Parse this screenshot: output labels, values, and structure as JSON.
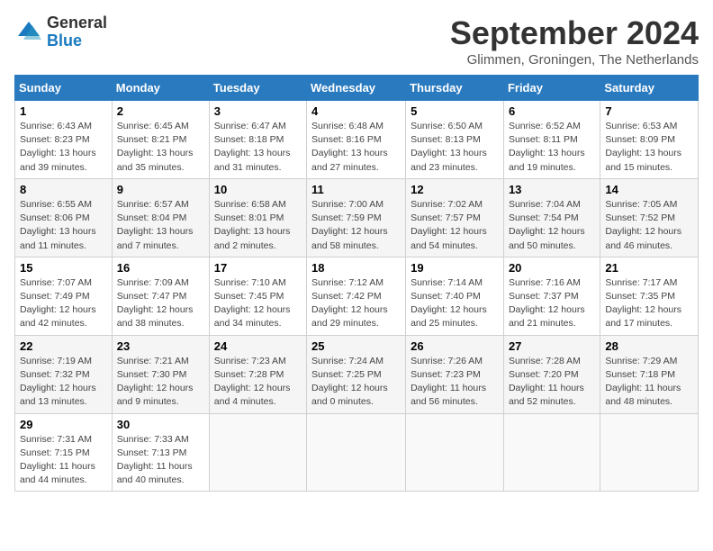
{
  "header": {
    "logo_general": "General",
    "logo_blue": "Blue",
    "month_title": "September 2024",
    "location": "Glimmen, Groningen, The Netherlands"
  },
  "weekdays": [
    "Sunday",
    "Monday",
    "Tuesday",
    "Wednesday",
    "Thursday",
    "Friday",
    "Saturday"
  ],
  "weeks": [
    [
      {
        "day": "1",
        "sunrise": "Sunrise: 6:43 AM",
        "sunset": "Sunset: 8:23 PM",
        "daylight": "Daylight: 13 hours and 39 minutes."
      },
      {
        "day": "2",
        "sunrise": "Sunrise: 6:45 AM",
        "sunset": "Sunset: 8:21 PM",
        "daylight": "Daylight: 13 hours and 35 minutes."
      },
      {
        "day": "3",
        "sunrise": "Sunrise: 6:47 AM",
        "sunset": "Sunset: 8:18 PM",
        "daylight": "Daylight: 13 hours and 31 minutes."
      },
      {
        "day": "4",
        "sunrise": "Sunrise: 6:48 AM",
        "sunset": "Sunset: 8:16 PM",
        "daylight": "Daylight: 13 hours and 27 minutes."
      },
      {
        "day": "5",
        "sunrise": "Sunrise: 6:50 AM",
        "sunset": "Sunset: 8:13 PM",
        "daylight": "Daylight: 13 hours and 23 minutes."
      },
      {
        "day": "6",
        "sunrise": "Sunrise: 6:52 AM",
        "sunset": "Sunset: 8:11 PM",
        "daylight": "Daylight: 13 hours and 19 minutes."
      },
      {
        "day": "7",
        "sunrise": "Sunrise: 6:53 AM",
        "sunset": "Sunset: 8:09 PM",
        "daylight": "Daylight: 13 hours and 15 minutes."
      }
    ],
    [
      {
        "day": "8",
        "sunrise": "Sunrise: 6:55 AM",
        "sunset": "Sunset: 8:06 PM",
        "daylight": "Daylight: 13 hours and 11 minutes."
      },
      {
        "day": "9",
        "sunrise": "Sunrise: 6:57 AM",
        "sunset": "Sunset: 8:04 PM",
        "daylight": "Daylight: 13 hours and 7 minutes."
      },
      {
        "day": "10",
        "sunrise": "Sunrise: 6:58 AM",
        "sunset": "Sunset: 8:01 PM",
        "daylight": "Daylight: 13 hours and 2 minutes."
      },
      {
        "day": "11",
        "sunrise": "Sunrise: 7:00 AM",
        "sunset": "Sunset: 7:59 PM",
        "daylight": "Daylight: 12 hours and 58 minutes."
      },
      {
        "day": "12",
        "sunrise": "Sunrise: 7:02 AM",
        "sunset": "Sunset: 7:57 PM",
        "daylight": "Daylight: 12 hours and 54 minutes."
      },
      {
        "day": "13",
        "sunrise": "Sunrise: 7:04 AM",
        "sunset": "Sunset: 7:54 PM",
        "daylight": "Daylight: 12 hours and 50 minutes."
      },
      {
        "day": "14",
        "sunrise": "Sunrise: 7:05 AM",
        "sunset": "Sunset: 7:52 PM",
        "daylight": "Daylight: 12 hours and 46 minutes."
      }
    ],
    [
      {
        "day": "15",
        "sunrise": "Sunrise: 7:07 AM",
        "sunset": "Sunset: 7:49 PM",
        "daylight": "Daylight: 12 hours and 42 minutes."
      },
      {
        "day": "16",
        "sunrise": "Sunrise: 7:09 AM",
        "sunset": "Sunset: 7:47 PM",
        "daylight": "Daylight: 12 hours and 38 minutes."
      },
      {
        "day": "17",
        "sunrise": "Sunrise: 7:10 AM",
        "sunset": "Sunset: 7:45 PM",
        "daylight": "Daylight: 12 hours and 34 minutes."
      },
      {
        "day": "18",
        "sunrise": "Sunrise: 7:12 AM",
        "sunset": "Sunset: 7:42 PM",
        "daylight": "Daylight: 12 hours and 29 minutes."
      },
      {
        "day": "19",
        "sunrise": "Sunrise: 7:14 AM",
        "sunset": "Sunset: 7:40 PM",
        "daylight": "Daylight: 12 hours and 25 minutes."
      },
      {
        "day": "20",
        "sunrise": "Sunrise: 7:16 AM",
        "sunset": "Sunset: 7:37 PM",
        "daylight": "Daylight: 12 hours and 21 minutes."
      },
      {
        "day": "21",
        "sunrise": "Sunrise: 7:17 AM",
        "sunset": "Sunset: 7:35 PM",
        "daylight": "Daylight: 12 hours and 17 minutes."
      }
    ],
    [
      {
        "day": "22",
        "sunrise": "Sunrise: 7:19 AM",
        "sunset": "Sunset: 7:32 PM",
        "daylight": "Daylight: 12 hours and 13 minutes."
      },
      {
        "day": "23",
        "sunrise": "Sunrise: 7:21 AM",
        "sunset": "Sunset: 7:30 PM",
        "daylight": "Daylight: 12 hours and 9 minutes."
      },
      {
        "day": "24",
        "sunrise": "Sunrise: 7:23 AM",
        "sunset": "Sunset: 7:28 PM",
        "daylight": "Daylight: 12 hours and 4 minutes."
      },
      {
        "day": "25",
        "sunrise": "Sunrise: 7:24 AM",
        "sunset": "Sunset: 7:25 PM",
        "daylight": "Daylight: 12 hours and 0 minutes."
      },
      {
        "day": "26",
        "sunrise": "Sunrise: 7:26 AM",
        "sunset": "Sunset: 7:23 PM",
        "daylight": "Daylight: 11 hours and 56 minutes."
      },
      {
        "day": "27",
        "sunrise": "Sunrise: 7:28 AM",
        "sunset": "Sunset: 7:20 PM",
        "daylight": "Daylight: 11 hours and 52 minutes."
      },
      {
        "day": "28",
        "sunrise": "Sunrise: 7:29 AM",
        "sunset": "Sunset: 7:18 PM",
        "daylight": "Daylight: 11 hours and 48 minutes."
      }
    ],
    [
      {
        "day": "29",
        "sunrise": "Sunrise: 7:31 AM",
        "sunset": "Sunset: 7:15 PM",
        "daylight": "Daylight: 11 hours and 44 minutes."
      },
      {
        "day": "30",
        "sunrise": "Sunrise: 7:33 AM",
        "sunset": "Sunset: 7:13 PM",
        "daylight": "Daylight: 11 hours and 40 minutes."
      },
      null,
      null,
      null,
      null,
      null
    ]
  ]
}
